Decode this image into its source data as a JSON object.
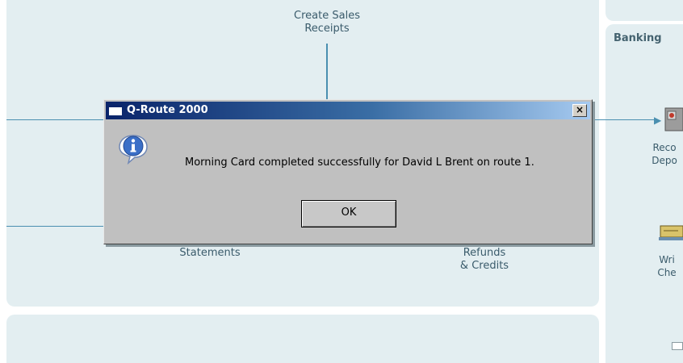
{
  "workflow": {
    "create_sales_receipts_line1": "Create Sales",
    "create_sales_receipts_line2": "Receipts",
    "statements": "Statements",
    "refunds_line1": "Refunds",
    "refunds_line2": "& Credits"
  },
  "banking": {
    "title": "Banking",
    "record_deposits_line1": "Reco",
    "record_deposits_line2": "Depo",
    "write_checks_line1": "Wri",
    "write_checks_line2": "Che"
  },
  "dialog": {
    "title": "Q-Route 2000",
    "close_glyph": "×",
    "message": "Morning Card completed successfully for David L Brent on route 1.",
    "ok_label": "OK",
    "icon": "info-icon"
  },
  "colors": {
    "panel_bg": "#e3eef1",
    "flow_line": "#4a8fb0",
    "title_bar_start": "#0a246a",
    "title_bar_end": "#a6caf0",
    "dialog_bg": "#c0c0c0"
  }
}
